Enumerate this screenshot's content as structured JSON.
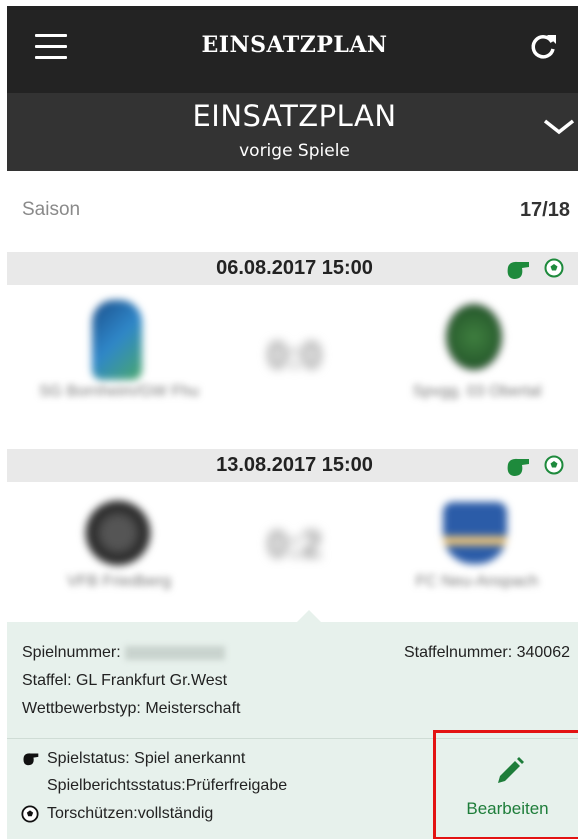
{
  "app": {
    "title": "EINSATZPLAN"
  },
  "header": {
    "title": "EINSATZPLAN",
    "subtitle": "vorige Spiele"
  },
  "season": {
    "label": "Saison",
    "value": "17/18"
  },
  "matches": [
    {
      "date": "06.08.2017 15:00",
      "home": "SG Bornheim/GW Fhu",
      "away": "Spvgg. 03 Obertal",
      "score": "0:0"
    },
    {
      "date": "13.08.2017 15:00",
      "home": "VFB Friedberg",
      "away": "FC Neu-Anspach",
      "score": "0:2"
    }
  ],
  "details": {
    "spielnummer_label": "Spielnummer:",
    "staffelnummer": "Staffelnummer: 340062",
    "staffel": "Staffel: GL Frankfurt Gr.West",
    "wettbewerb": "Wettbewerbstyp: Meisterschaft",
    "spielstatus": "Spielstatus: Spiel anerkannt",
    "berichtsstatus": "Spielberichtsstatus:Prüferfreigabe",
    "torschuetzen": "Torschützen:vollständig",
    "edit_label": "Bearbeiten"
  },
  "icons": [
    "menu-icon",
    "refresh-icon",
    "chevron-down-icon",
    "whistle-icon",
    "soccer-ball-icon",
    "pencil-icon"
  ],
  "colors": {
    "appbar": "#232323",
    "subbar": "#333333",
    "accent_green": "#1e7d3a",
    "highlight_red": "#e31212",
    "details_bg": "#e7f1ec"
  }
}
